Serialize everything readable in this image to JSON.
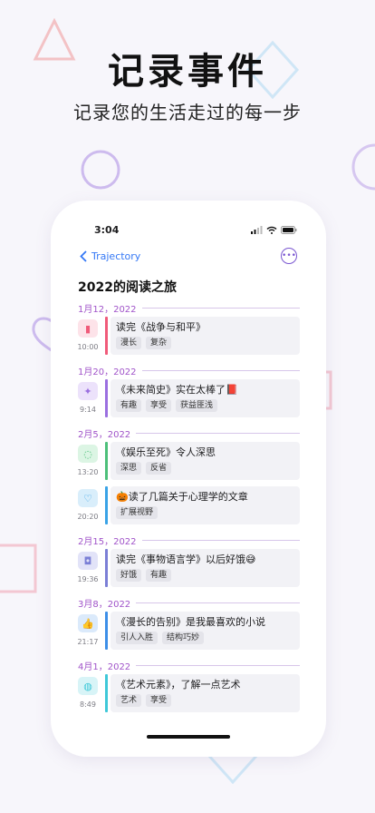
{
  "hero": {
    "title": "记录事件",
    "subtitle": "记录您的生活走过的每一步"
  },
  "status_bar": {
    "time": "3:04"
  },
  "nav": {
    "back_label": "Trajectory",
    "more_icon": "ellipsis-circle-icon"
  },
  "page_title": "2022的阅读之旅",
  "colors": {
    "accent": "#7a57d1",
    "date": "#a053c9",
    "link": "#3478f6"
  },
  "groups": [
    {
      "date": "1月12，2022",
      "entries": [
        {
          "time": "10:00",
          "title": "读完《战争与和平》",
          "tags": [
            "漫长",
            "复杂"
          ],
          "icon": "book-icon",
          "color": "#f05b7a",
          "bg": "#fde3e9",
          "glyph": "▮"
        }
      ]
    },
    {
      "date": "1月20，2022",
      "entries": [
        {
          "time": "9:14",
          "title": "《未来简史》实在太棒了📕",
          "tags": [
            "有趣",
            "享受",
            "获益匪浅"
          ],
          "icon": "sparkles-icon",
          "color": "#9b6fe0",
          "bg": "#ece2fb",
          "glyph": "✦"
        }
      ]
    },
    {
      "date": "2月5，2022",
      "entries": [
        {
          "time": "13:20",
          "title": "《娱乐至死》令人深思",
          "tags": [
            "深思",
            "反省"
          ],
          "icon": "lightbulb-icon",
          "color": "#4dc07a",
          "bg": "#dcf5e4",
          "glyph": "◌"
        },
        {
          "time": "20:20",
          "title": "🎃读了几篇关于心理学的文章",
          "tags": [
            "扩展视野"
          ],
          "icon": "heart-icon",
          "color": "#3aa3e6",
          "bg": "#d9eefb",
          "glyph": "♡"
        }
      ]
    },
    {
      "date": "2月15，2022",
      "entries": [
        {
          "time": "19:36",
          "title": "读完《事物语言学》以后好饿😅",
          "tags": [
            "好饿",
            "有趣"
          ],
          "icon": "cake-icon",
          "color": "#7b7fd6",
          "bg": "#e2e3f8",
          "glyph": "◘"
        }
      ]
    },
    {
      "date": "3月8，2022",
      "entries": [
        {
          "time": "21:17",
          "title": "《漫长的告别》是我最喜欢的小说",
          "tags": [
            "引人入胜",
            "结构巧妙"
          ],
          "icon": "thumbs-up-icon",
          "color": "#3d8fe8",
          "bg": "#dbeafb",
          "glyph": "👍"
        }
      ]
    },
    {
      "date": "4月1，2022",
      "entries": [
        {
          "time": "8:49",
          "title": "《艺术元素》，了解一点艺术",
          "tags": [
            "艺术",
            "享受"
          ],
          "icon": "palette-icon",
          "color": "#3fc8d8",
          "bg": "#d8f4f7",
          "glyph": "◍"
        }
      ]
    }
  ]
}
